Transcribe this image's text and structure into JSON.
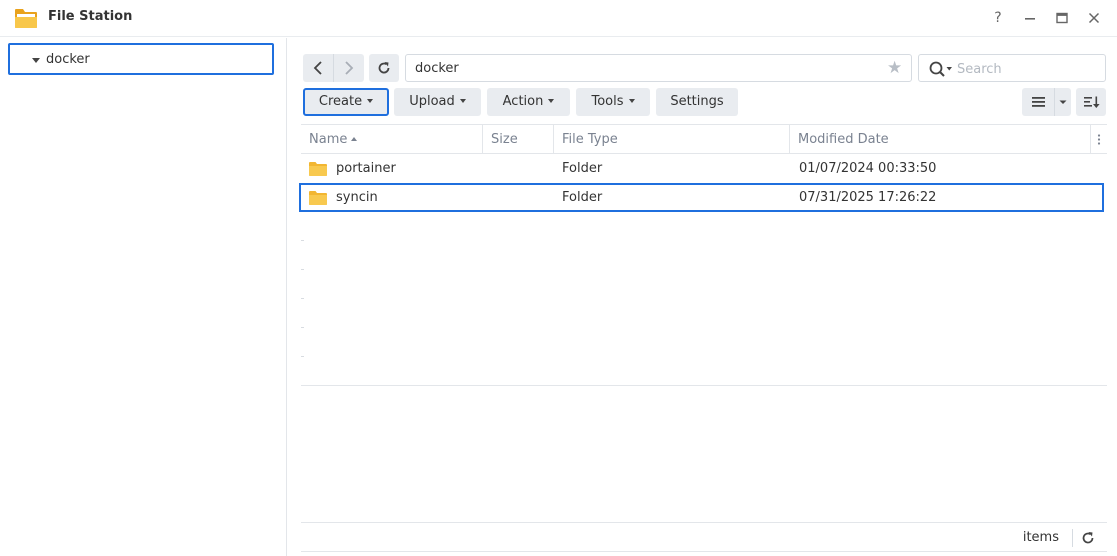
{
  "window": {
    "title": "File Station",
    "controls": {
      "help": "?",
      "minimize": "—",
      "maximize": "▭",
      "close": "✕"
    }
  },
  "sidebar": {
    "tree": [
      {
        "label": "docker",
        "expanded": true,
        "selected": true
      }
    ]
  },
  "toolbar": {
    "path": "docker",
    "search_placeholder": "Search",
    "buttons": {
      "create": "Create",
      "upload": "Upload",
      "action": "Action",
      "tools": "Tools",
      "settings": "Settings"
    }
  },
  "list": {
    "columns": {
      "name": "Name",
      "size": "Size",
      "file_type": "File Type",
      "modified_date": "Modified Date"
    },
    "rows": [
      {
        "name": "portainer",
        "size": "",
        "file_type": "Folder",
        "modified": "01/07/2024 00:33:50",
        "selected": false
      },
      {
        "name": "syncin",
        "size": "",
        "file_type": "Folder",
        "modified": "07/31/2025 17:26:22",
        "selected": true
      }
    ]
  },
  "status": {
    "items_label": "items"
  },
  "colors": {
    "accent": "#1f6fde",
    "folder": "#f6c344",
    "button_bg": "#e9ecf0"
  }
}
